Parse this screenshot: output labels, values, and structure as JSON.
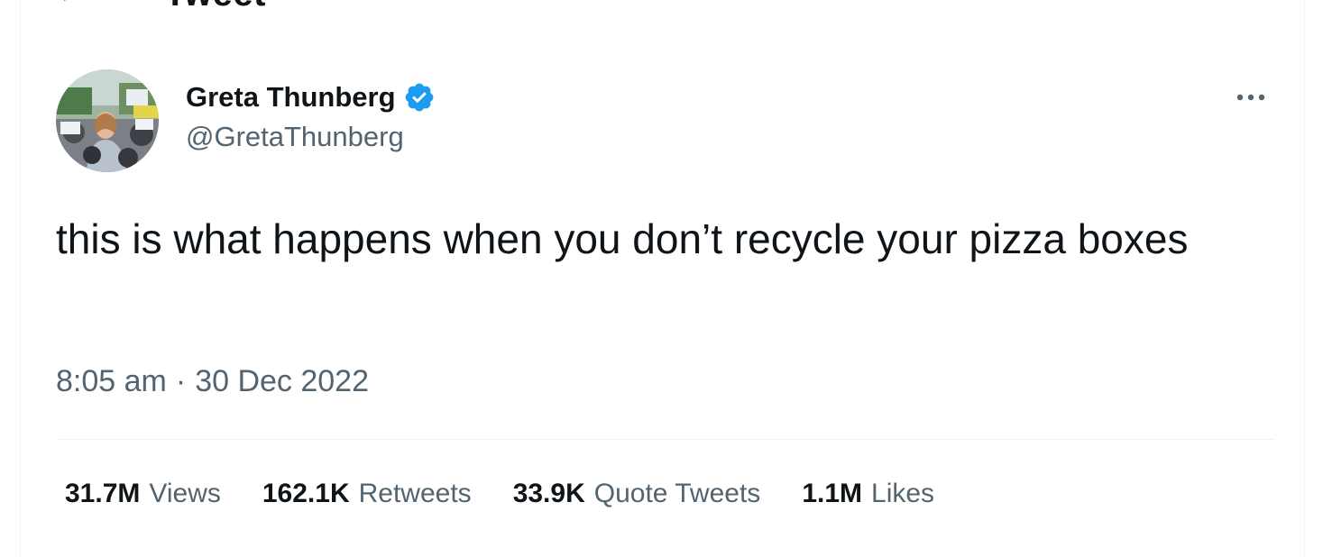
{
  "header": {
    "title": "Tweet"
  },
  "tweet": {
    "author": {
      "display_name": "Greta Thunberg",
      "handle": "@GretaThunberg",
      "verified": true,
      "verified_color": "#1d9bf0"
    },
    "text": "this is what happens when you don’t recycle your pizza boxes",
    "time": "8:05 am",
    "separator": "·",
    "date": "30 Dec 2022",
    "stats": [
      {
        "value": "31.7M",
        "label": "Views"
      },
      {
        "value": "162.1K",
        "label": "Retweets"
      },
      {
        "value": "33.9K",
        "label": "Quote Tweets"
      },
      {
        "value": "1.1M",
        "label": "Likes"
      }
    ]
  },
  "colors": {
    "text_primary": "#0f1419",
    "text_secondary": "#536471",
    "divider": "#eff3f4"
  },
  "icons": {
    "back": "back-arrow-icon",
    "verified": "verified-badge-icon",
    "more": "more-options-icon"
  }
}
